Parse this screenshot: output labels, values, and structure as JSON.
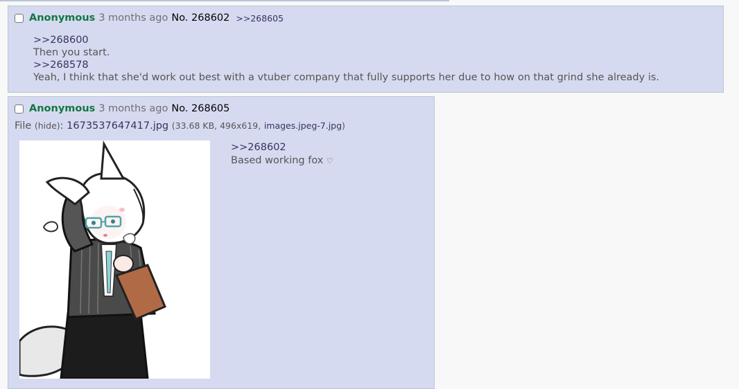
{
  "posts": [
    {
      "name": "Anonymous",
      "time": "3 months ago",
      "number": "No. 268602",
      "backlink": ">>268605",
      "lines": [
        ">>268600",
        "Then you start.",
        ">>268578",
        "Yeah, I think that she'd work out best with a vtuber company that fully supports her due to how on that grind she already is."
      ]
    },
    {
      "name": "Anonymous",
      "time": "3 months ago",
      "number": "No. 268605",
      "file": {
        "label": "File",
        "hide": "(hide)",
        "separator": ":",
        "filename": "1673537647417.jpg",
        "meta_open": "(33.68 KB, 496x619,",
        "original_name": "images.jpeg-7.jpg",
        "meta_close": ")"
      },
      "thumbnail_alt": "anime fox girl with glasses holding clipboard",
      "lines": [
        ">>268602",
        "Based working fox"
      ],
      "heart_glyph": "♡"
    }
  ],
  "colors": {
    "post_bg": "#d6daf0",
    "post_border": "#b7c5d9",
    "name": "#117743",
    "link": "#34345c"
  }
}
